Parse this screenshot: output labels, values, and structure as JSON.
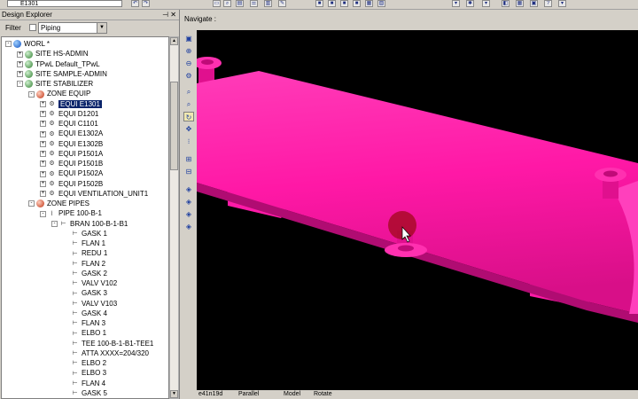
{
  "toolbar": {
    "combo_value": "E1301"
  },
  "explorer": {
    "title": "Design Explorer",
    "filter_label": "Filter",
    "filter_value": "Piping",
    "tree": [
      {
        "label": "WORL *",
        "level": 0,
        "icon": "world",
        "exp": "-"
      },
      {
        "label": "SITE HS-ADMIN",
        "level": 1,
        "icon": "site",
        "exp": "+"
      },
      {
        "label": "TPwL Default_TPwL",
        "level": 1,
        "icon": "site",
        "exp": "+"
      },
      {
        "label": "SITE SAMPLE-ADMIN",
        "level": 1,
        "icon": "site",
        "exp": "+"
      },
      {
        "label": "SITE STABILIZER",
        "level": 1,
        "icon": "site",
        "exp": "-"
      },
      {
        "label": "ZONE EQUIP",
        "level": 2,
        "icon": "zone",
        "exp": "-"
      },
      {
        "label": "EQUI E1301",
        "level": 3,
        "icon": "equi",
        "exp": "+",
        "selected": true
      },
      {
        "label": "EQUI D1201",
        "level": 3,
        "icon": "equi",
        "exp": "+"
      },
      {
        "label": "EQUI C1101",
        "level": 3,
        "icon": "equi",
        "exp": "+"
      },
      {
        "label": "EQUI E1302A",
        "level": 3,
        "icon": "equi",
        "exp": "+"
      },
      {
        "label": "EQUI E1302B",
        "level": 3,
        "icon": "equi",
        "exp": "+"
      },
      {
        "label": "EQUI P1501A",
        "level": 3,
        "icon": "equi",
        "exp": "+"
      },
      {
        "label": "EQUI P1501B",
        "level": 3,
        "icon": "equi",
        "exp": "+"
      },
      {
        "label": "EQUI P1502A",
        "level": 3,
        "icon": "equi",
        "exp": "+"
      },
      {
        "label": "EQUI P1502B",
        "level": 3,
        "icon": "equi",
        "exp": "+"
      },
      {
        "label": "EQUI VENTILATION_UNIT1",
        "level": 3,
        "icon": "equi",
        "exp": "+"
      },
      {
        "label": "ZONE PIPES",
        "level": 2,
        "icon": "zone",
        "exp": "-"
      },
      {
        "label": "PIPE 100-B-1",
        "level": 3,
        "icon": "pipe",
        "exp": "-"
      },
      {
        "label": "BRAN 100-B-1-B1",
        "level": 4,
        "icon": "comp",
        "exp": "-"
      },
      {
        "label": "GASK 1",
        "level": 5,
        "icon": "comp"
      },
      {
        "label": "FLAN 1",
        "level": 5,
        "icon": "comp"
      },
      {
        "label": "REDU 1",
        "level": 5,
        "icon": "comp"
      },
      {
        "label": "FLAN 2",
        "level": 5,
        "icon": "comp"
      },
      {
        "label": "GASK 2",
        "level": 5,
        "icon": "comp"
      },
      {
        "label": "VALV V102",
        "level": 5,
        "icon": "comp"
      },
      {
        "label": "GASK 3",
        "level": 5,
        "icon": "comp"
      },
      {
        "label": "VALV V103",
        "level": 5,
        "icon": "comp"
      },
      {
        "label": "GASK 4",
        "level": 5,
        "icon": "comp"
      },
      {
        "label": "FLAN 3",
        "level": 5,
        "icon": "comp"
      },
      {
        "label": "ELBO 1",
        "level": 5,
        "icon": "comp"
      },
      {
        "label": "TEE 100-B-1-B1-TEE1",
        "level": 5,
        "icon": "comp"
      },
      {
        "label": "ATTA XXXX=204/320",
        "level": 5,
        "icon": "comp"
      },
      {
        "label": "ELBO 2",
        "level": 5,
        "icon": "comp"
      },
      {
        "label": "ELBO 3",
        "level": 5,
        "icon": "comp"
      },
      {
        "label": "FLAN 4",
        "level": 5,
        "icon": "comp"
      },
      {
        "label": "GASK 5",
        "level": 5,
        "icon": "comp"
      }
    ]
  },
  "viewport": {
    "title": "Navigate :"
  },
  "status": {
    "item1": "e41n19d",
    "item2": "Parallel",
    "item3": "Model",
    "item4": "Rotate"
  },
  "colors": {
    "model": "#ff1aa8",
    "model_dark": "#c0107e",
    "selection": "#0a246a"
  }
}
